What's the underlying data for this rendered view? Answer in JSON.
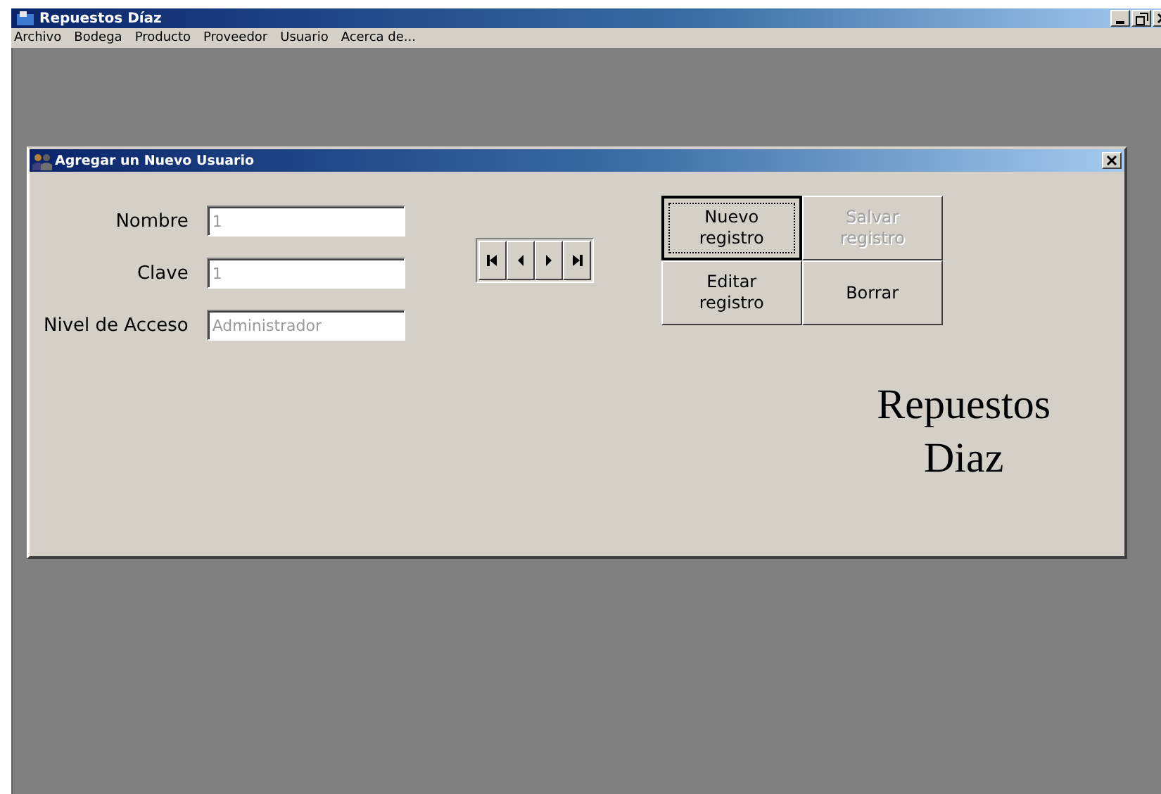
{
  "window": {
    "title": "Repuestos Díaz"
  },
  "menu": [
    {
      "label": "Archivo"
    },
    {
      "label": "Bodega"
    },
    {
      "label": "Producto"
    },
    {
      "label": "Proveedor"
    },
    {
      "label": "Usuario"
    },
    {
      "label": "Acerca de..."
    }
  ],
  "dialog": {
    "title": "Agregar un  Nuevo Usuario",
    "fields": [
      {
        "label": "Nombre",
        "value": "1",
        "disabled": true
      },
      {
        "label": "Clave",
        "value": "1",
        "disabled": true
      },
      {
        "label": "Nivel de Acceso",
        "value": "Administrador",
        "disabled": true
      }
    ],
    "navigator": [
      {
        "kind": "first"
      },
      {
        "kind": "prev"
      },
      {
        "kind": "next"
      },
      {
        "kind": "last"
      }
    ],
    "buttons": [
      {
        "label": "Nuevo registro",
        "disabled": false,
        "focused": true
      },
      {
        "label": "Salvar registro",
        "disabled": true,
        "focused": false
      },
      {
        "label": "Editar registro",
        "disabled": false,
        "focused": false
      },
      {
        "label": "Borrar",
        "disabled": false,
        "focused": false
      }
    ],
    "logo": [
      "Repuestos",
      "Diaz"
    ]
  }
}
